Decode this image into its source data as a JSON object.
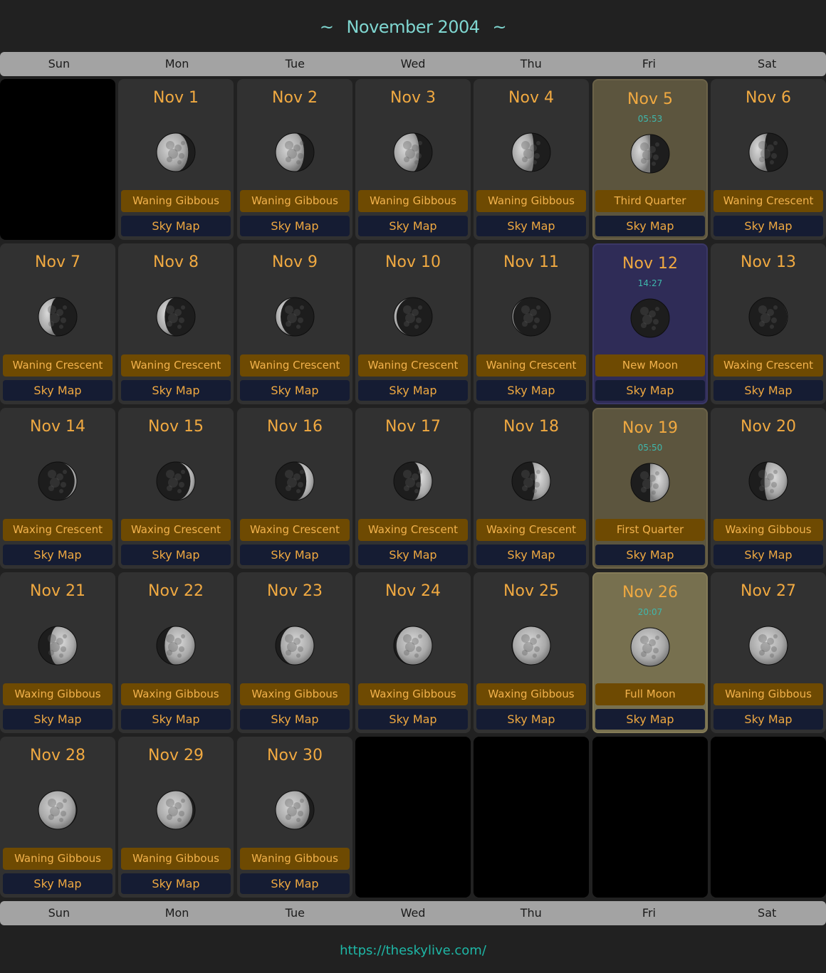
{
  "header": {
    "title": "November 2004",
    "deco": "~"
  },
  "weekdays": [
    "Sun",
    "Mon",
    "Tue",
    "Wed",
    "Thu",
    "Fri",
    "Sat"
  ],
  "sky_map_label": "Sky Map",
  "days": [
    {
      "date": "Nov 1",
      "phase": "Waning Gibbous",
      "illum": 0.82,
      "waxing": false
    },
    {
      "date": "Nov 2",
      "phase": "Waning Gibbous",
      "illum": 0.74,
      "waxing": false
    },
    {
      "date": "Nov 3",
      "phase": "Waning Gibbous",
      "illum": 0.66,
      "waxing": false
    },
    {
      "date": "Nov 4",
      "phase": "Waning Gibbous",
      "illum": 0.57,
      "waxing": false
    },
    {
      "date": "Nov 5",
      "time": "05:53",
      "phase": "Third Quarter",
      "illum": 0.5,
      "waxing": false,
      "special": "q"
    },
    {
      "date": "Nov 6",
      "phase": "Waning Crescent",
      "illum": 0.4,
      "waxing": false
    },
    {
      "date": "Nov 7",
      "phase": "Waning Crescent",
      "illum": 0.3,
      "waxing": false
    },
    {
      "date": "Nov 8",
      "phase": "Waning Crescent",
      "illum": 0.21,
      "waxing": false
    },
    {
      "date": "Nov 9",
      "phase": "Waning Crescent",
      "illum": 0.13,
      "waxing": false
    },
    {
      "date": "Nov 10",
      "phase": "Waning Crescent",
      "illum": 0.07,
      "waxing": false
    },
    {
      "date": "Nov 11",
      "phase": "Waning Crescent",
      "illum": 0.03,
      "waxing": false
    },
    {
      "date": "Nov 12",
      "time": "14:27",
      "phase": "New Moon",
      "illum": 0.0,
      "waxing": true,
      "special": "new"
    },
    {
      "date": "Nov 13",
      "phase": "Waxing Crescent",
      "illum": 0.01,
      "waxing": true
    },
    {
      "date": "Nov 14",
      "phase": "Waxing Crescent",
      "illum": 0.06,
      "waxing": true
    },
    {
      "date": "Nov 15",
      "phase": "Waxing Crescent",
      "illum": 0.12,
      "waxing": true
    },
    {
      "date": "Nov 16",
      "phase": "Waxing Crescent",
      "illum": 0.2,
      "waxing": true
    },
    {
      "date": "Nov 17",
      "phase": "Waxing Crescent",
      "illum": 0.3,
      "waxing": true
    },
    {
      "date": "Nov 18",
      "phase": "Waxing Crescent",
      "illum": 0.4,
      "waxing": true
    },
    {
      "date": "Nov 19",
      "time": "05:50",
      "phase": "First Quarter",
      "illum": 0.5,
      "waxing": true,
      "special": "q"
    },
    {
      "date": "Nov 20",
      "phase": "Waxing Gibbous",
      "illum": 0.6,
      "waxing": true
    },
    {
      "date": "Nov 21",
      "phase": "Waxing Gibbous",
      "illum": 0.7,
      "waxing": true
    },
    {
      "date": "Nov 22",
      "phase": "Waxing Gibbous",
      "illum": 0.79,
      "waxing": true
    },
    {
      "date": "Nov 23",
      "phase": "Waxing Gibbous",
      "illum": 0.87,
      "waxing": true
    },
    {
      "date": "Nov 24",
      "phase": "Waxing Gibbous",
      "illum": 0.93,
      "waxing": true
    },
    {
      "date": "Nov 25",
      "phase": "Waxing Gibbous",
      "illum": 0.98,
      "waxing": true
    },
    {
      "date": "Nov 26",
      "time": "20:07",
      "phase": "Full Moon",
      "illum": 1.0,
      "waxing": true,
      "special": "full"
    },
    {
      "date": "Nov 27",
      "phase": "Waning Gibbous",
      "illum": 0.99,
      "waxing": false
    },
    {
      "date": "Nov 28",
      "phase": "Waning Gibbous",
      "illum": 0.97,
      "waxing": false
    },
    {
      "date": "Nov 29",
      "phase": "Waning Gibbous",
      "illum": 0.93,
      "waxing": false
    },
    {
      "date": "Nov 30",
      "phase": "Waning Gibbous",
      "illum": 0.88,
      "waxing": false
    }
  ],
  "leading_blank_days": 1,
  "trailing_blank_days": 4,
  "footer": {
    "link_text": "https://theskylive.com/"
  }
}
